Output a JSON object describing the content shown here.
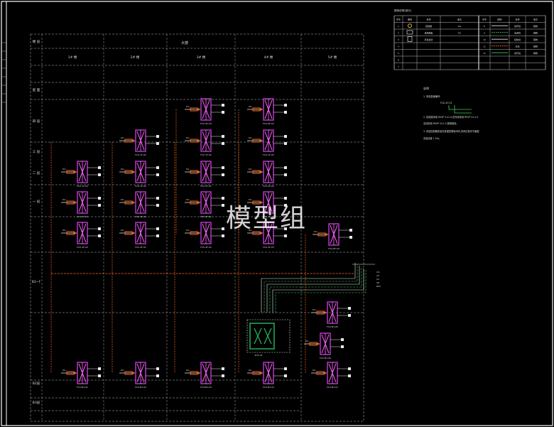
{
  "watermark": "模型组",
  "colors": {
    "background": "#000000",
    "frame": "#ffffff",
    "grid": "#7a7a7a",
    "box": "#c03bd0",
    "box_inner": "#ff66ff",
    "cable": "#ff6a1a",
    "wire_green": "#35d15a",
    "wire_white": "#e8e8e8",
    "ahu_outline": "#20c05c"
  },
  "header": {
    "col_labels": [
      "1# 楼",
      "2# 楼",
      "3# 楼",
      "4# 楼",
      "5# 楼"
    ],
    "top_label": "大楼"
  },
  "row_labels": [
    "楼 层",
    "屋 面",
    "四 层",
    "三 层",
    "二 层",
    "一 层",
    "B1~F",
    "B2层",
    "B3层"
  ],
  "equipment": {
    "ahu_tag": "AHU-01",
    "unit_tags": [
      "FCU-1F-01",
      "FCU-1F-02",
      "FCU-1F-03",
      "FCU-1F-04",
      "FCU-1F-05",
      "FCU-2F-01",
      "FCU-2F-02",
      "FCU-2F-03",
      "FCU-2F-04",
      "FCU-3F-01",
      "FCU-3F-02",
      "FCU-3F-03",
      "FCU-4F-01",
      "FCU-4F-02",
      "FCU-4F-03",
      "FCU-4F-04",
      "FCU-RF-03",
      "FCU-RF-04",
      "FCU-B1-01",
      "FCU-B1-02",
      "FCU-B1-03",
      "FCU-B1-04",
      "FCU-B1-05",
      "FCU-B1-06",
      "FCU-B1-07"
    ]
  },
  "legend": {
    "title": "图例说明(部分)",
    "headers": [
      "序号",
      "图例",
      "名称",
      "备注",
      "序号",
      "图例",
      "名称",
      "备注"
    ],
    "rows": [
      [
        "1",
        "",
        "控制器",
        "DG",
        "8",
        "",
        "信号线",
        "暗敷"
      ],
      [
        "2",
        "",
        "温控面板",
        "DG",
        "9",
        "",
        "电源线",
        "暗敷"
      ],
      [
        "3",
        "",
        "风机盘管",
        "",
        "10",
        "",
        "控制线",
        "暗敷"
      ],
      [
        "4",
        "",
        "",
        "",
        "11",
        "",
        "总线",
        "暗敷"
      ],
      [
        "5",
        "",
        "",
        "",
        "12",
        "",
        "通讯线",
        "暗敷"
      ],
      [
        "6",
        "",
        "",
        "",
        "",
        "",
        "",
        ""
      ],
      [
        "7",
        "",
        "",
        "",
        "",
        "",
        "",
        ""
      ]
    ]
  },
  "notes": {
    "title": "说明",
    "lines": [
      "1. 风机盘管编号:",
      "FCU-4F-01",
      "2. 控制线采用 RVVP 2×1.0,信号线采用 RVVP 2×1.0",
      "   总线采用 RVSP 2×1.5,穿管敷设。",
      "3. 系统控制器安装在各楼层弱电间内,具体位置详平面图",
      "   安装高度 1.5m。"
    ]
  }
}
